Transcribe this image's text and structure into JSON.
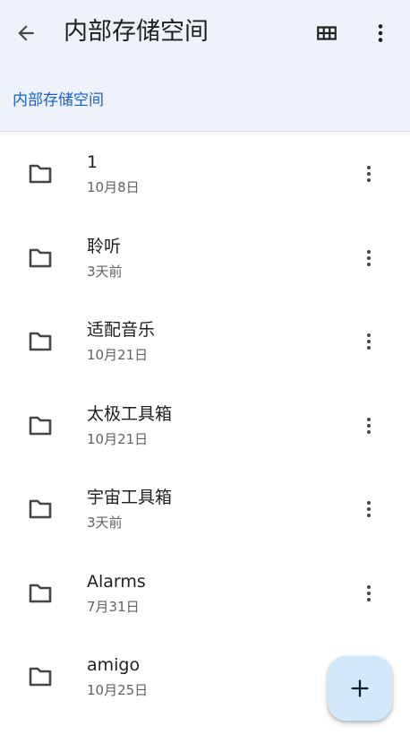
{
  "header": {
    "title": "内部存储空间",
    "breadcrumb": "内部存储空间",
    "icons": {
      "back": "arrow-back-icon",
      "view": "grid-view-icon",
      "more": "more-vert-icon"
    }
  },
  "files": [
    {
      "name": "1",
      "date": "10月8日"
    },
    {
      "name": "聆听",
      "date": "3天前"
    },
    {
      "name": "适配音乐",
      "date": "10月21日"
    },
    {
      "name": "太极工具箱",
      "date": "10月21日"
    },
    {
      "name": "宇宙工具箱",
      "date": "3天前"
    },
    {
      "name": "Alarms",
      "date": "7月31日"
    },
    {
      "name": "amigo",
      "date": "10月25日"
    }
  ],
  "colors": {
    "header_bg": "#eef2fb",
    "accent": "#1a5fc9",
    "fab_bg": "#d2e8fb"
  },
  "fab": {
    "icon": "add-icon"
  }
}
